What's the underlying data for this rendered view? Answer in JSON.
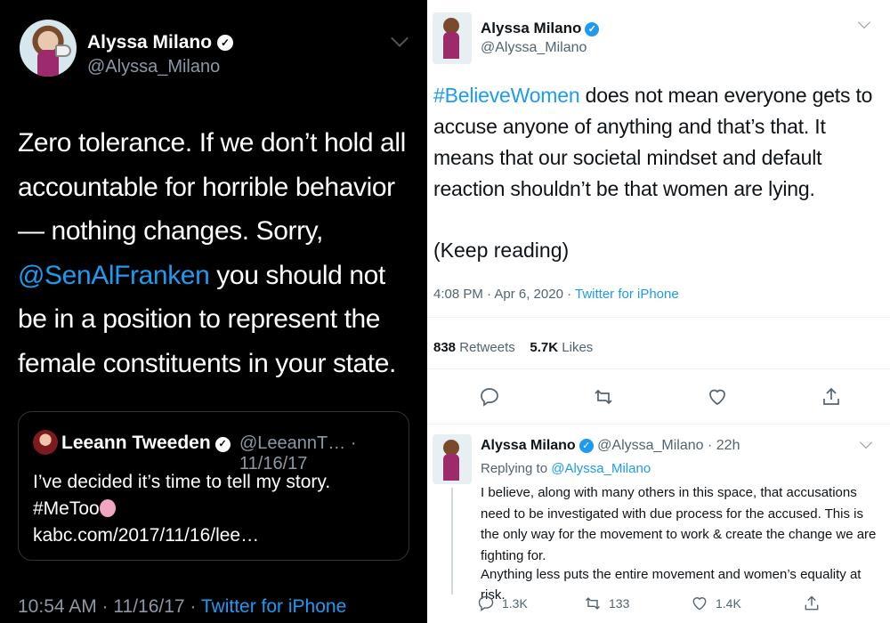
{
  "left_tweet": {
    "author_name": "Alyssa Milano",
    "author_handle": "@Alyssa_Milano",
    "text_before": "Zero tolerance. If we don’t hold all accountable for horrible behavior — nothing changes. Sorry, ",
    "mention": "@SenAlFranken",
    "text_after": " you should not be in a position to represent the female constituents in your state.",
    "quote": {
      "author_name": "Leeann Tweeden",
      "handle_date": "@LeeannT… · 11/16/17",
      "line1": "I’ve decided it’s time to tell my story.",
      "hashtag": "#MeToo",
      "link": "kabc.com/2017/11/16/lee…"
    },
    "meta_time": "10:54 AM · 11/16/17 · ",
    "meta_source": "Twitter for iPhone",
    "colors": {
      "background": "#000000",
      "link": "#1d9bf0",
      "muted": "#8b98a5"
    }
  },
  "right_tweet": {
    "author_name": "Alyssa Milano",
    "author_handle": "@Alyssa_Milano",
    "hashtag": "#BelieveWomen",
    "text": " does not mean everyone gets to accuse anyone of anything and that’s that. It means that our societal mindset and default reaction shouldn’t be that women are lying.",
    "keep_reading": "(Keep reading)",
    "meta_time": "4:08 PM · Apr 6, 2020 · ",
    "meta_source": "Twitter for iPhone",
    "retweets_count": "838",
    "retweets_label": "Retweets",
    "likes_count": "5.7K",
    "likes_label": "Likes",
    "actions": [
      "reply-icon",
      "retweet-icon",
      "like-icon",
      "share-icon"
    ]
  },
  "reply_tweet": {
    "author_name": "Alyssa Milano",
    "handle_time": "@Alyssa_Milano · 22h",
    "replying_prefix": "Replying to ",
    "replying_to": "@Alyssa_Milano",
    "paragraph1": "I believe, along with many others in this space, that accusations need to be investigated with due process for the accused. This is the only way for the movement to work & create the change we are fighting for.",
    "paragraph2": "Anything less puts the entire movement and women’s equality at risk.",
    "reply_count": "1.3K",
    "retweet_count": "133",
    "like_count": "1.4K"
  }
}
